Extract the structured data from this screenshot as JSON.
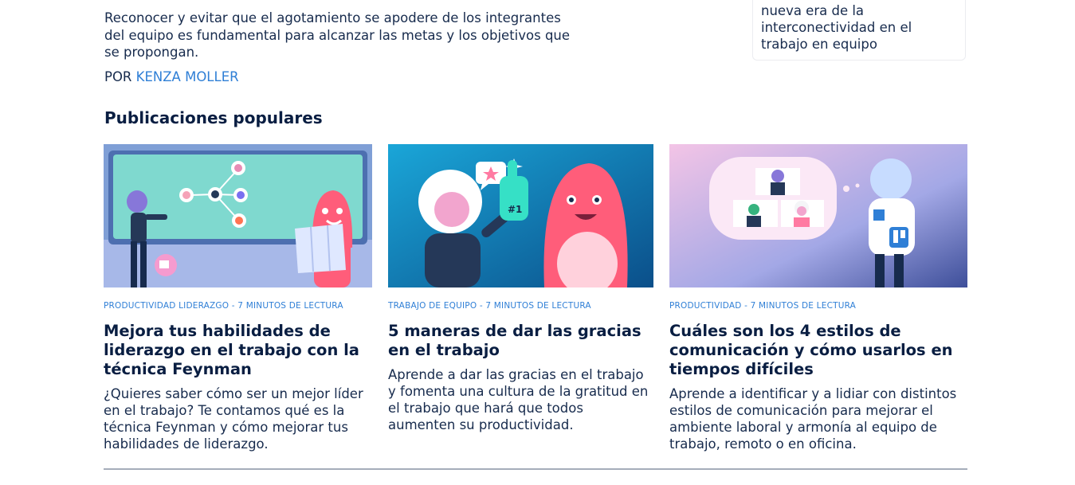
{
  "top_article": {
    "excerpt": "Reconocer y evitar que el agotamiento se apodere de los integrantes del equipo es fundamental para alcanzar las metas y los objetivos que se propongan.",
    "by_label": "POR",
    "author": "KENZA MOLLER"
  },
  "side_card": {
    "title": "nueva era de la interconectividad en el trabajo en equipo"
  },
  "popular": {
    "heading": "Publicaciones populares",
    "cards": [
      {
        "category": "PRODUCTIVIDAD",
        "category2": "LIDERAZGO",
        "read_time": " - 7 MINUTOS DE LECTURA",
        "title": "Mejora tus habilidades de liderazgo en el trabajo con la técnica Feynman",
        "description": "¿Quieres saber cómo ser un mejor líder en el trabajo? Te contamos qué es la técnica Feynman y cómo mejorar tus habilidades de liderazgo."
      },
      {
        "category": "TRABAJO DE EQUIPO",
        "read_time": " - 7 MINUTOS DE LECTURA",
        "title": "5 maneras de dar las gracias en el trabajo",
        "description": "Aprende a dar las gracias en el trabajo y fomenta una cultura de la gratitud en el trabajo que hará que todos aumenten su productividad."
      },
      {
        "category": "PRODUCTIVIDAD",
        "read_time": " - 7 MINUTOS DE LECTURA",
        "title": "Cuáles son los 4 estilos de comunicación y cómo usarlos en tiempos difíciles",
        "description": "Aprende a identificar y a lidiar con distintos estilos de comunicación para mejorar el ambiente laboral y armonía al equipo de trabajo, remoto o en oficina."
      }
    ]
  },
  "colors": {
    "link": "#2f7fd6",
    "heading": "#091e42",
    "body_text": "#172b4d",
    "divider": "#a5adba"
  }
}
